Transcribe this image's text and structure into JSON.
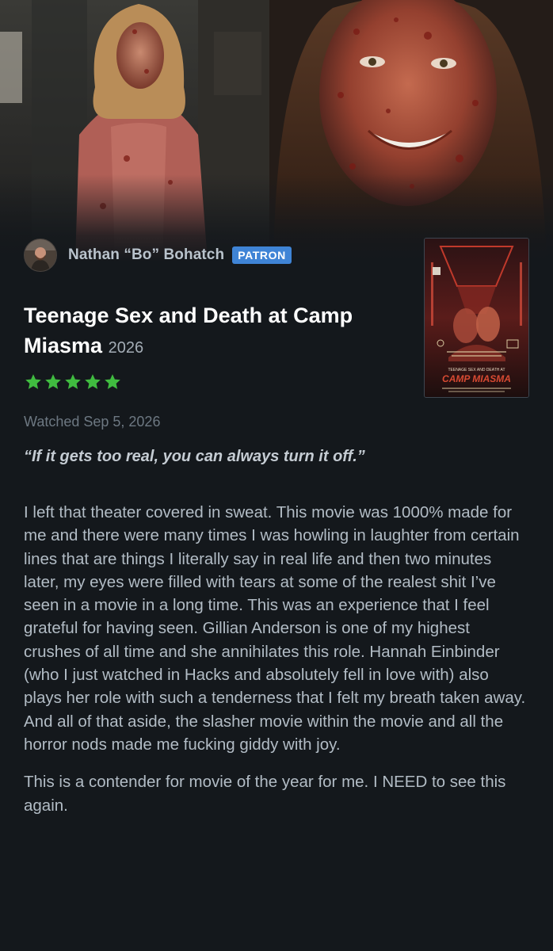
{
  "reviewer": {
    "name": "Nathan “Bo” Bohatch",
    "badge": "PATRON"
  },
  "film": {
    "title": "Teenage Sex and Death at Camp Miasma",
    "year": "2026",
    "rating_stars": 5,
    "rating_max": 5
  },
  "watched_label": "Watched Sep 5, 2026",
  "tagline": "“If it gets too real, you can always turn it off.”",
  "review": {
    "paragraphs": [
      "I left that theater covered in sweat. This movie was 1000% made for me and there were many times I was howling in laughter from certain lines that are things I literally say in real life and then two minutes later, my eyes were filled with tears at some of the realest shit I’ve seen in a movie in a long time. This was an experience that I feel grateful for having seen. Gillian Anderson is one of my highest crushes of all time and she annihilates this role. Hannah Einbinder (who I just watched in Hacks and absolutely fell in love with) also plays her role with such a tenderness that I felt my breath taken away. And all of that aside, the slasher movie within the movie and all the horror nods made me fucking giddy with joy.",
      "This is a contender for movie of the year for me. I NEED to see this again."
    ]
  },
  "poster": {
    "title_small": "TEENAGE SEX AND DEATH AT",
    "title_large": "CAMP MIASMA"
  },
  "colors": {
    "background": "#14181c",
    "star_green": "#40bc40",
    "patron_blue": "#3f84d6",
    "title_white": "#ffffff"
  },
  "icons": {
    "star": "star-icon",
    "avatar": "avatar"
  }
}
